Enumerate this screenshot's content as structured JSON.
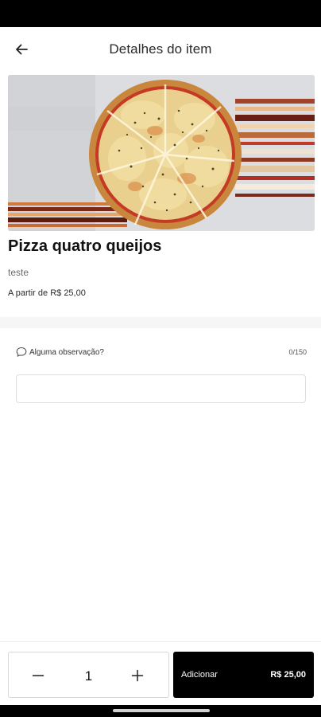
{
  "header": {
    "title": "Detalhes do item"
  },
  "icons": {
    "back": "arrow-left-icon",
    "observation": "chat-bubble-icon",
    "minus": "minus-icon",
    "plus": "plus-icon"
  },
  "item": {
    "name": "Pizza quatro queijos",
    "description": "teste",
    "price_label": "A partir de R$ 25,00"
  },
  "observation": {
    "label": "Alguma observação?",
    "counter": "0/150",
    "value": "",
    "placeholder": ""
  },
  "quantity": {
    "value": "1"
  },
  "add_button": {
    "label": "Adicionar",
    "price": "R$ 25,00"
  },
  "colors": {
    "primary": "#000000",
    "background": "#ffffff",
    "separator": "#f6f6f6",
    "border": "#dedede"
  }
}
